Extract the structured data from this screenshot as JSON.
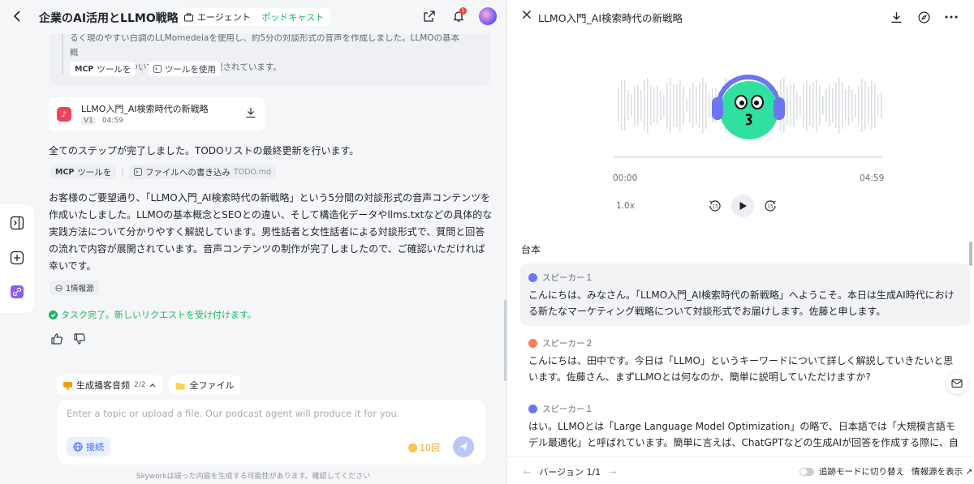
{
  "header": {
    "title": "企業のAI活用とLLMO戦略",
    "agent_label": "エージェント",
    "podcast_label": "ポッドキャスト",
    "notification_count": "1"
  },
  "left": {
    "quote_line1": "るく現のやすい白調のLLMomedeiaを使用し、約5分の対談形式の音声を作成しました。LLMOの基本概",
    "quote_line2": "念と実践方法について分かりやすく解説されています。",
    "tool1": {
      "mcp": "MCP",
      "label": "ツールを",
      "action": "ツールを使用"
    },
    "audio_card": {
      "title": "LLMO入門_AI検索時代の新戦略",
      "version": "V1",
      "duration": "04:59"
    },
    "msg1": "全てのステップが完了しました。TODOリストの最終更新を行います。",
    "tool2": {
      "mcp": "MCP",
      "label": "ツールを",
      "action": "ファイルへの書き込み",
      "file": "TODO.md"
    },
    "msg2": "お客様のご要望通り、「LLMO入門_AI検索時代の新戦略」という5分間の対談形式の音声コンテンツを作成いたしました。LLMOの基本概念とSEOとの違い、そして構造化データやllms.txtなどの具体的な実践方法について分かりやすく解説しています。男性話者と女性話者による対談形式で、質問と回答の流れで内容が展開されています。音声コンテンツの制作が完了しましたので、ご確認いただければ幸いです。",
    "source_count": "1情報源",
    "done_text": "タスク完了。新しいリクエストを受け付けます。",
    "chip_generate": "生成播客音频",
    "chip_generate_count": "2/2",
    "chip_files": "全ファイル",
    "composer_placeholder": "Enter a topic or upload a file. Our podcast agent will produce it for you.",
    "connect_label": "接続",
    "credits": "10回",
    "disclaimer": "Skyworkは誤った内容を生成する可能性があります。確認してください"
  },
  "player": {
    "title": "LLMO入門_AI検索時代の新戦略",
    "current_time": "00:00",
    "total_time": "04:59",
    "progress": 0.0,
    "speed": "1.0x",
    "skip_back": "15",
    "skip_forward": "15"
  },
  "script": {
    "title": "台本",
    "turns": [
      {
        "speaker": "スピーカー１",
        "text": "こんにちは、みなさん。「LLMO入門_AI検索時代の新戦略」へようこそ。本日は生成AI時代における新たなマーケティング戦略について対談形式でお届けします。佐藤と申します。"
      },
      {
        "speaker": "スピーカー２",
        "text": "こんにちは、田中です。今日は「LLMO」というキーワードについて詳しく解説していきたいと思います。佐藤さん、まずLLMOとは何なのか、簡単に説明していただけますか?"
      },
      {
        "speaker": "スピーカー１",
        "text": "はい。LLMOとは「Large Language Model Optimization」の略で、日本語では「大規模言語モデル最適化」と呼ばれています。簡単に言えば、ChatGPTなどの生成AIが回答を作成する際に、自社の情報を優先的に引用・参照してもらうための対策のことです。"
      }
    ]
  },
  "footer": {
    "version": "バージョン 1/1",
    "track_mode": "追跡モードに切り替え",
    "show_sources": "情報源を表示 ↗"
  },
  "colors": {
    "accent_green": "#1bb55c",
    "accent_blue": "#3b6cf6",
    "mascot": "#2fe0a0",
    "headphones": "#6b76f0"
  }
}
